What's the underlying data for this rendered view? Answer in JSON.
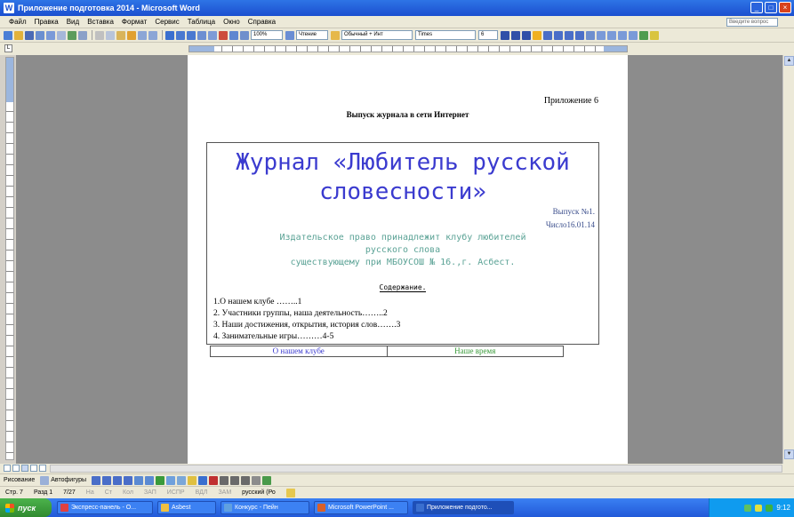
{
  "window": {
    "title": "Приложение подготовка 2014 - Microsoft Word",
    "minimize": "_",
    "maximize": "□",
    "close": "×"
  },
  "menubar": {
    "items": [
      "Файл",
      "Правка",
      "Вид",
      "Вставка",
      "Формат",
      "Сервис",
      "Таблица",
      "Окно",
      "Справка"
    ],
    "help_placeholder": "Введите вопрос"
  },
  "toolbar": {
    "zoom": "100%",
    "view_label": "Чтение",
    "style": "Обычный + Инт",
    "font": "Times",
    "size": "6"
  },
  "document": {
    "appendix": "Приложение 6",
    "subtitle": "Выпуск журнала в сети Интернет",
    "journal_title": "Журнал «Любитель русской словесности»",
    "issue": "Выпуск №1.",
    "date": "Число16.01.14",
    "rights_line1": "Издательское право принадлежит клубу любителей",
    "rights_line2": "русского слова",
    "rights_line3": "существующему при МБОУСОШ № 16.,г. Асбест.",
    "contents_heading": "Содержание.",
    "toc": [
      "1.О нашем клубе ……..1",
      "2. Участники группы, наша деятельность……..2",
      "3. Наши достижения, открытия, история слов…….3",
      "4. Занимательные игры………4-5"
    ],
    "link_left": "О нашем клубе",
    "link_right": "Наше время"
  },
  "drawbar": {
    "draw_label": "Рисование",
    "autoshapes_label": "Автофигуры"
  },
  "statusbar": {
    "page": "Стр. 7",
    "section": "Разд 1",
    "pages": "7/27",
    "position": "На",
    "line": "Ст",
    "column": "Кол",
    "rec": "ЗАП",
    "track": "ИСПР",
    "ext": "ВДЛ",
    "ovr": "ЗАМ",
    "lang": "русский (Ро"
  },
  "taskbar": {
    "start": "пуск",
    "tasks": [
      "Экспресс-панель - О...",
      "Asbest",
      "Конкурс - Пейн",
      "Microsoft PowerPoint ...",
      "Приложение подгото..."
    ],
    "clock": "9:12"
  },
  "colors": {
    "journal_title": "#3b3bcf",
    "rights_text": "#5aa295",
    "link_left": "#3b3bcf",
    "link_right": "#3a9a3a",
    "titlebar": "#1b4fcf"
  }
}
